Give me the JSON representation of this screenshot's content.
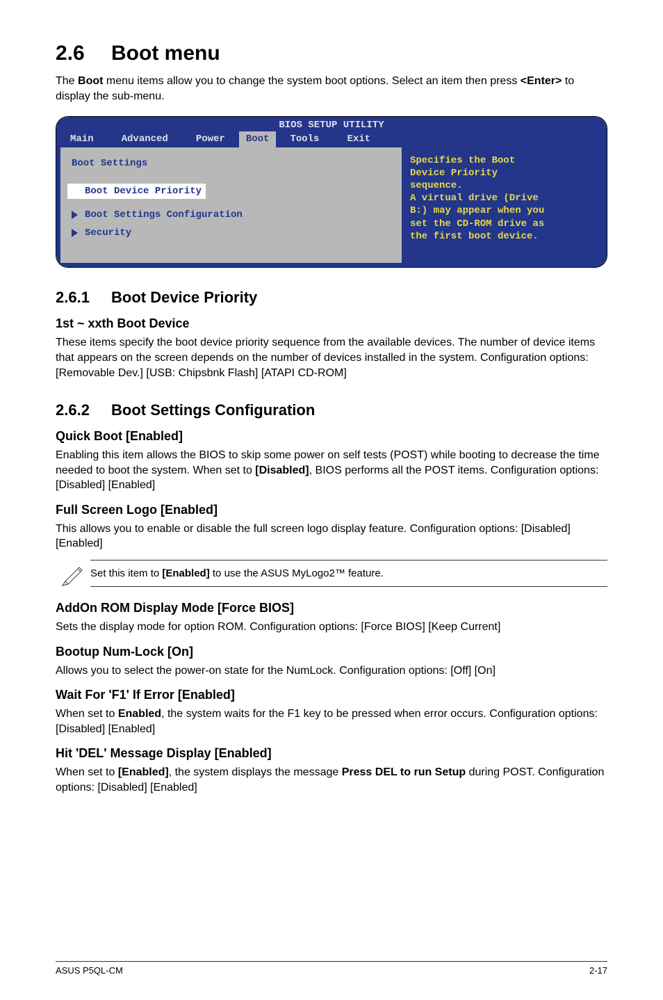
{
  "section": {
    "num": "2.6",
    "title": "Boot menu",
    "intro_a": "The ",
    "intro_bold1": "Boot",
    "intro_b": " menu items allow you to change the system boot options. Select an item then press ",
    "intro_bold2": "<Enter>",
    "intro_c": " to display the sub-menu."
  },
  "bios": {
    "title": "BIOS SETUP UTILITY",
    "tabs": {
      "main": "Main",
      "advanced": "Advanced",
      "power": "Power",
      "boot": "Boot",
      "tools": "Tools",
      "exit": "Exit"
    },
    "left": {
      "header": "Boot Settings",
      "item1": "Boot Device Priority",
      "item2": "Boot Settings Configuration",
      "item3": "Security"
    },
    "right": {
      "l1": "Specifies the Boot",
      "l2": "Device Priority",
      "l3": "sequence.",
      "l4": "",
      "l5": "A virtual drive (Drive",
      "l6": "B:) may appear when you",
      "l7": "set the CD-ROM drive as",
      "l8": "the first boot device."
    }
  },
  "s261": {
    "num": "2.6.1",
    "title": "Boot Device Priority",
    "sub": "1st ~ xxth Boot Device",
    "p": "These items specify the boot device priority sequence from the available devices. The number of device items that appears on the screen depends on the number of devices installed in the system. Configuration options: [Removable Dev.] [USB: Chipsbnk Flash] [ATAPI CD-ROM]"
  },
  "s262": {
    "num": "2.6.2",
    "title": "Boot Settings Configuration",
    "qb_h": "Quick Boot [Enabled]",
    "qb_a": "Enabling this item allows the BIOS to skip some power on self tests (POST) while booting to decrease the time needed to boot the system. When set to ",
    "qb_bold": "[Disabled]",
    "qb_b": ", BIOS performs all the POST items. Configuration options: [Disabled] [Enabled]",
    "fsl_h": "Full Screen Logo [Enabled]",
    "fsl_p": "This allows you to enable or disable the full screen logo display feature. Configuration options: [Disabled] [Enabled]",
    "note_a": "Set this item to ",
    "note_bold": "[Enabled]",
    "note_b": " to use the ASUS MyLogo2™ feature.",
    "arom_h": "AddOn ROM Display Mode [Force BIOS]",
    "arom_p": "Sets the display mode for option ROM. Configuration options: [Force BIOS] [Keep Current]",
    "num_h": "Bootup Num-Lock [On]",
    "num_p": "Allows you to select the power-on state for the NumLock. Configuration options: [Off] [On]",
    "f1_h": "Wait For 'F1' If Error [Enabled]",
    "f1_a": "When set to ",
    "f1_bold": "Enabled",
    "f1_b": ", the system waits for the F1 key to be pressed when error occurs. Configuration options: [Disabled] [Enabled]",
    "del_h": "Hit 'DEL' Message Display [Enabled]",
    "del_a": "When set to ",
    "del_bold1": "[Enabled]",
    "del_b": ", the system displays the message ",
    "del_bold2": "Press DEL to run Setup",
    "del_c": " during POST. Configuration options: [Disabled] [Enabled]"
  },
  "footer": {
    "left": "ASUS P5QL-CM",
    "right": "2-17"
  }
}
